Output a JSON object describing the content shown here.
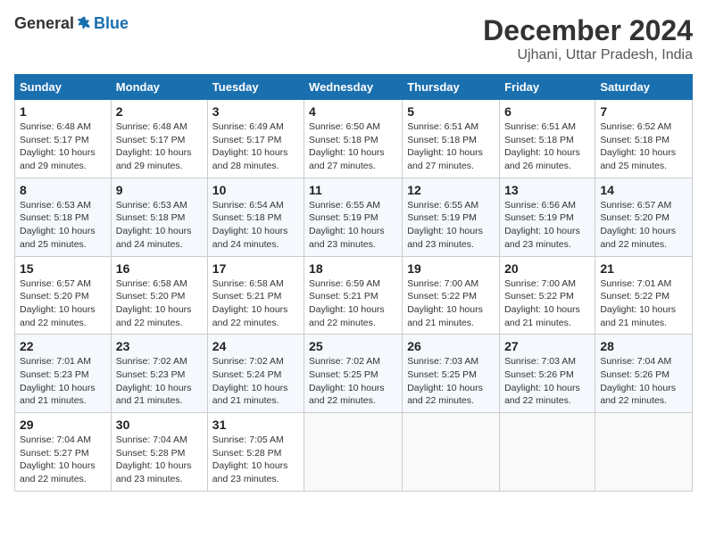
{
  "logo": {
    "general": "General",
    "blue": "Blue"
  },
  "title": "December 2024",
  "location": "Ujhani, Uttar Pradesh, India",
  "weekdays": [
    "Sunday",
    "Monday",
    "Tuesday",
    "Wednesday",
    "Thursday",
    "Friday",
    "Saturday"
  ],
  "weeks": [
    [
      {
        "day": "1",
        "sunrise": "6:48 AM",
        "sunset": "5:17 PM",
        "daylight": "10 hours and 29 minutes."
      },
      {
        "day": "2",
        "sunrise": "6:48 AM",
        "sunset": "5:17 PM",
        "daylight": "10 hours and 29 minutes."
      },
      {
        "day": "3",
        "sunrise": "6:49 AM",
        "sunset": "5:17 PM",
        "daylight": "10 hours and 28 minutes."
      },
      {
        "day": "4",
        "sunrise": "6:50 AM",
        "sunset": "5:18 PM",
        "daylight": "10 hours and 27 minutes."
      },
      {
        "day": "5",
        "sunrise": "6:51 AM",
        "sunset": "5:18 PM",
        "daylight": "10 hours and 27 minutes."
      },
      {
        "day": "6",
        "sunrise": "6:51 AM",
        "sunset": "5:18 PM",
        "daylight": "10 hours and 26 minutes."
      },
      {
        "day": "7",
        "sunrise": "6:52 AM",
        "sunset": "5:18 PM",
        "daylight": "10 hours and 25 minutes."
      }
    ],
    [
      {
        "day": "8",
        "sunrise": "6:53 AM",
        "sunset": "5:18 PM",
        "daylight": "10 hours and 25 minutes."
      },
      {
        "day": "9",
        "sunrise": "6:53 AM",
        "sunset": "5:18 PM",
        "daylight": "10 hours and 24 minutes."
      },
      {
        "day": "10",
        "sunrise": "6:54 AM",
        "sunset": "5:18 PM",
        "daylight": "10 hours and 24 minutes."
      },
      {
        "day": "11",
        "sunrise": "6:55 AM",
        "sunset": "5:19 PM",
        "daylight": "10 hours and 23 minutes."
      },
      {
        "day": "12",
        "sunrise": "6:55 AM",
        "sunset": "5:19 PM",
        "daylight": "10 hours and 23 minutes."
      },
      {
        "day": "13",
        "sunrise": "6:56 AM",
        "sunset": "5:19 PM",
        "daylight": "10 hours and 23 minutes."
      },
      {
        "day": "14",
        "sunrise": "6:57 AM",
        "sunset": "5:20 PM",
        "daylight": "10 hours and 22 minutes."
      }
    ],
    [
      {
        "day": "15",
        "sunrise": "6:57 AM",
        "sunset": "5:20 PM",
        "daylight": "10 hours and 22 minutes."
      },
      {
        "day": "16",
        "sunrise": "6:58 AM",
        "sunset": "5:20 PM",
        "daylight": "10 hours and 22 minutes."
      },
      {
        "day": "17",
        "sunrise": "6:58 AM",
        "sunset": "5:21 PM",
        "daylight": "10 hours and 22 minutes."
      },
      {
        "day": "18",
        "sunrise": "6:59 AM",
        "sunset": "5:21 PM",
        "daylight": "10 hours and 22 minutes."
      },
      {
        "day": "19",
        "sunrise": "7:00 AM",
        "sunset": "5:22 PM",
        "daylight": "10 hours and 21 minutes."
      },
      {
        "day": "20",
        "sunrise": "7:00 AM",
        "sunset": "5:22 PM",
        "daylight": "10 hours and 21 minutes."
      },
      {
        "day": "21",
        "sunrise": "7:01 AM",
        "sunset": "5:22 PM",
        "daylight": "10 hours and 21 minutes."
      }
    ],
    [
      {
        "day": "22",
        "sunrise": "7:01 AM",
        "sunset": "5:23 PM",
        "daylight": "10 hours and 21 minutes."
      },
      {
        "day": "23",
        "sunrise": "7:02 AM",
        "sunset": "5:23 PM",
        "daylight": "10 hours and 21 minutes."
      },
      {
        "day": "24",
        "sunrise": "7:02 AM",
        "sunset": "5:24 PM",
        "daylight": "10 hours and 21 minutes."
      },
      {
        "day": "25",
        "sunrise": "7:02 AM",
        "sunset": "5:25 PM",
        "daylight": "10 hours and 22 minutes."
      },
      {
        "day": "26",
        "sunrise": "7:03 AM",
        "sunset": "5:25 PM",
        "daylight": "10 hours and 22 minutes."
      },
      {
        "day": "27",
        "sunrise": "7:03 AM",
        "sunset": "5:26 PM",
        "daylight": "10 hours and 22 minutes."
      },
      {
        "day": "28",
        "sunrise": "7:04 AM",
        "sunset": "5:26 PM",
        "daylight": "10 hours and 22 minutes."
      }
    ],
    [
      {
        "day": "29",
        "sunrise": "7:04 AM",
        "sunset": "5:27 PM",
        "daylight": "10 hours and 22 minutes."
      },
      {
        "day": "30",
        "sunrise": "7:04 AM",
        "sunset": "5:28 PM",
        "daylight": "10 hours and 23 minutes."
      },
      {
        "day": "31",
        "sunrise": "7:05 AM",
        "sunset": "5:28 PM",
        "daylight": "10 hours and 23 minutes."
      },
      null,
      null,
      null,
      null
    ]
  ]
}
